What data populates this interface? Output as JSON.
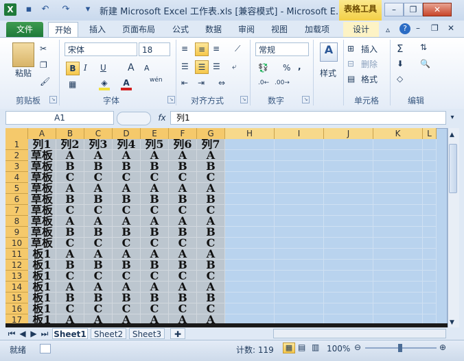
{
  "titlebar": {
    "title": "新建 Microsoft Excel 工作表.xls  [兼容模式] - Microsoft E...",
    "context_tab": "表格工具",
    "app_icon_letter": "X"
  },
  "tabs": [
    "文件",
    "开始",
    "插入",
    "页面布局",
    "公式",
    "数据",
    "审阅",
    "视图",
    "加载项",
    "设计"
  ],
  "ribbon": {
    "clipboard": {
      "paste": "粘贴",
      "label": "剪贴板"
    },
    "font": {
      "name": "宋体",
      "size": "18",
      "bold": "B",
      "italic": "I",
      "underline": "U",
      "grow": "A",
      "shrink": "A",
      "label": "字体",
      "wen": "wén"
    },
    "align": {
      "label": "对齐方式"
    },
    "number": {
      "format": "常规",
      "percent": "%",
      "comma": ",",
      "label": "数字"
    },
    "styles": {
      "label": "样式"
    },
    "cells": {
      "insert": "插入",
      "delete": "删除",
      "format": "格式",
      "label": "单元格"
    },
    "editing": {
      "label": "编辑"
    }
  },
  "formula_bar": {
    "name_box": "A1",
    "fx": "fx",
    "content": "列1"
  },
  "grid": {
    "columns": [
      "A",
      "B",
      "C",
      "D",
      "E",
      "F",
      "G",
      "H",
      "I",
      "J",
      "K",
      "L"
    ],
    "header_row": [
      "列1",
      "列2",
      "列3",
      "列4",
      "列5",
      "列6",
      "列7"
    ],
    "rows": [
      {
        "n": "1",
        "cells": [
          "列1",
          "列2",
          "列3",
          "列4",
          "列5",
          "列6",
          "列7"
        ]
      },
      {
        "n": "2",
        "cells": [
          "草板",
          "A",
          "A",
          "A",
          "A",
          "A",
          "A"
        ]
      },
      {
        "n": "3",
        "cells": [
          "草板",
          "B",
          "B",
          "B",
          "B",
          "B",
          "B"
        ]
      },
      {
        "n": "4",
        "cells": [
          "草板",
          "C",
          "C",
          "C",
          "C",
          "C",
          "C"
        ]
      },
      {
        "n": "5",
        "cells": [
          "草板",
          "A",
          "A",
          "A",
          "A",
          "A",
          "A"
        ]
      },
      {
        "n": "6",
        "cells": [
          "草板",
          "B",
          "B",
          "B",
          "B",
          "B",
          "B"
        ]
      },
      {
        "n": "7",
        "cells": [
          "草板",
          "C",
          "C",
          "C",
          "C",
          "C",
          "C"
        ]
      },
      {
        "n": "8",
        "cells": [
          "草板",
          "A",
          "A",
          "A",
          "A",
          "A",
          "A"
        ]
      },
      {
        "n": "9",
        "cells": [
          "草板",
          "B",
          "B",
          "B",
          "B",
          "B",
          "B"
        ]
      },
      {
        "n": "10",
        "cells": [
          "草板",
          "C",
          "C",
          "C",
          "C",
          "C",
          "C"
        ]
      },
      {
        "n": "11",
        "cells": [
          "板1",
          "A",
          "A",
          "A",
          "A",
          "A",
          "A"
        ]
      },
      {
        "n": "12",
        "cells": [
          "板1",
          "B",
          "B",
          "B",
          "B",
          "B",
          "B"
        ]
      },
      {
        "n": "13",
        "cells": [
          "板1",
          "C",
          "C",
          "C",
          "C",
          "C",
          "C"
        ]
      },
      {
        "n": "14",
        "cells": [
          "板1",
          "A",
          "A",
          "A",
          "A",
          "A",
          "A"
        ]
      },
      {
        "n": "15",
        "cells": [
          "板1",
          "B",
          "B",
          "B",
          "B",
          "B",
          "B"
        ]
      },
      {
        "n": "16",
        "cells": [
          "板1",
          "C",
          "C",
          "C",
          "C",
          "C",
          "C"
        ]
      },
      {
        "n": "17",
        "cells": [
          "板1",
          "A",
          "A",
          "A",
          "A",
          "A",
          "A"
        ]
      }
    ]
  },
  "sheets": [
    "Sheet1",
    "Sheet2",
    "Sheet3"
  ],
  "statusbar": {
    "mode": "就绪",
    "count": "计数: 119",
    "zoom": "100%"
  },
  "colors": {
    "accent": "#1f7a3a",
    "selection": "#b9d3ee",
    "header": "#f5c96b"
  }
}
